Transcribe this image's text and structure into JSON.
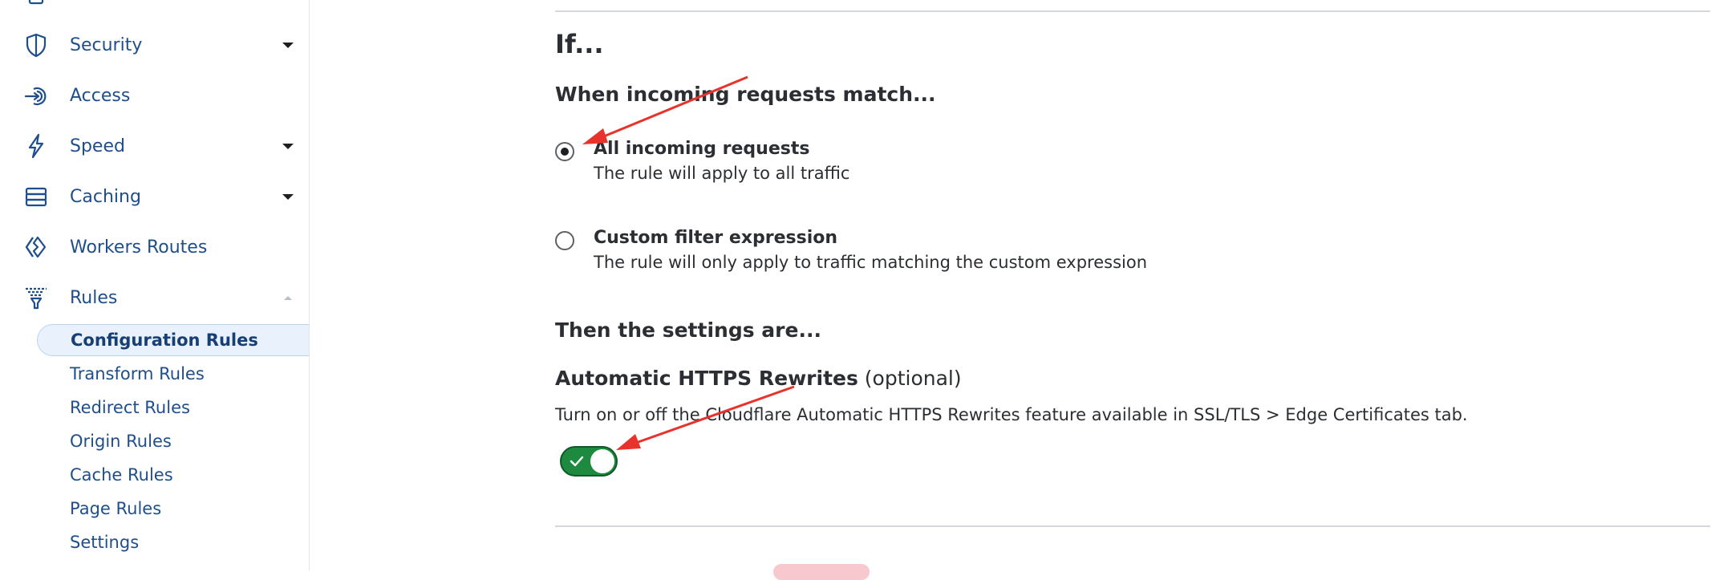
{
  "sidebar": {
    "items": [
      {
        "label": "Security",
        "icon": "shield-icon",
        "caret": "down"
      },
      {
        "label": "Access",
        "icon": "access-icon",
        "caret": ""
      },
      {
        "label": "Speed",
        "icon": "lightning-icon",
        "caret": "down"
      },
      {
        "label": "Caching",
        "icon": "storage-icon",
        "caret": "down"
      },
      {
        "label": "Workers Routes",
        "icon": "workers-icon",
        "caret": ""
      },
      {
        "label": "Rules",
        "icon": "rules-funnel-icon",
        "caret": "up"
      }
    ],
    "subitems": [
      {
        "label": "Configuration Rules",
        "active": true
      },
      {
        "label": "Transform Rules"
      },
      {
        "label": "Redirect Rules"
      },
      {
        "label": "Origin Rules"
      },
      {
        "label": "Cache Rules"
      },
      {
        "label": "Page Rules"
      },
      {
        "label": "Settings"
      }
    ]
  },
  "main": {
    "if_heading": "If...",
    "when_heading": "When incoming requests match...",
    "options": [
      {
        "title": "All incoming requests",
        "desc": "The rule will apply to all traffic",
        "selected": true
      },
      {
        "title": "Custom filter expression",
        "desc": "The rule will only apply to traffic matching the custom expression",
        "selected": false
      }
    ],
    "then_heading": "Then the settings are...",
    "https_title": "Automatic HTTPS Rewrites",
    "https_optional": " (optional)",
    "https_desc": "Turn on or off the Cloudflare Automatic HTTPS Rewrites feature available in SSL/TLS > Edge Certificates tab.",
    "https_toggle_on": true
  },
  "colors": {
    "nav_text": "#1f4e8c",
    "active_bg": "#e9f1fc",
    "toggle_on": "#1e8a3f",
    "annotation_arrow": "#e8322b"
  }
}
